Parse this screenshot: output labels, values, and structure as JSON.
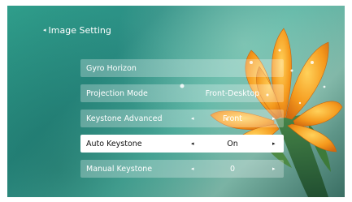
{
  "header": {
    "back_glyph": "◂",
    "title": "Image Setting"
  },
  "menu": {
    "arrow_left": "◂",
    "arrow_right": "▸",
    "items": [
      {
        "label": "Gyro Horizon",
        "value": ""
      },
      {
        "label": "Projection Mode",
        "value": "Front-Desktop"
      },
      {
        "label": "Keystone Advanced",
        "value": "Front"
      },
      {
        "label": "Auto Keystone",
        "value": "On"
      },
      {
        "label": "Manual Keystone",
        "value": "0"
      }
    ],
    "selected_index": 3
  },
  "colors": {
    "background_teal": "#2f9d8a",
    "petal_orange": "#f39a1e",
    "selected_row": "#ffffff"
  }
}
